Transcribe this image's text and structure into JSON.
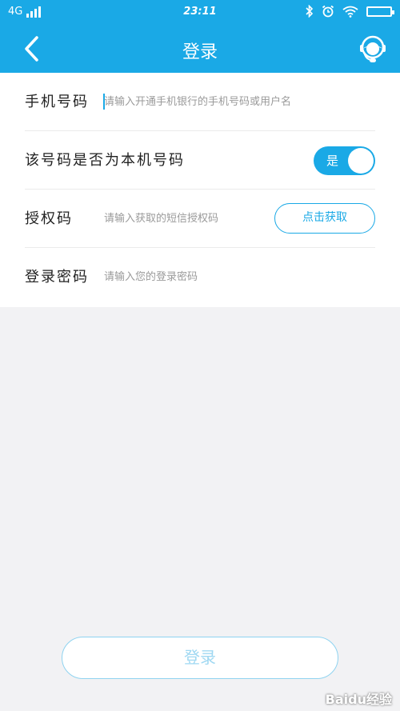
{
  "status_bar": {
    "network": "4G",
    "time": "23:11",
    "icons": [
      "bluetooth-icon",
      "alarm-icon",
      "wifi-icon",
      "battery-icon"
    ]
  },
  "nav": {
    "title": "登录",
    "back_icon": "chevron-left-icon",
    "service_icon": "customer-service-icon"
  },
  "form": {
    "phone": {
      "label": "手机号码",
      "placeholder": "请输入开通手机银行的手机号码或用户名"
    },
    "is_own_number": {
      "label": "该号码是否为本机号码",
      "toggle_text": "是",
      "toggle_on": true
    },
    "auth_code": {
      "label": "授权码",
      "placeholder": "请输入获取的短信授权码",
      "button": "点击获取"
    },
    "password": {
      "label": "登录密码",
      "placeholder": "请输入您的登录密码"
    }
  },
  "login_button": "登录",
  "watermark": "Baidu经验",
  "colors": {
    "brand": "#1aa9e6",
    "background": "#f2f2f4"
  }
}
